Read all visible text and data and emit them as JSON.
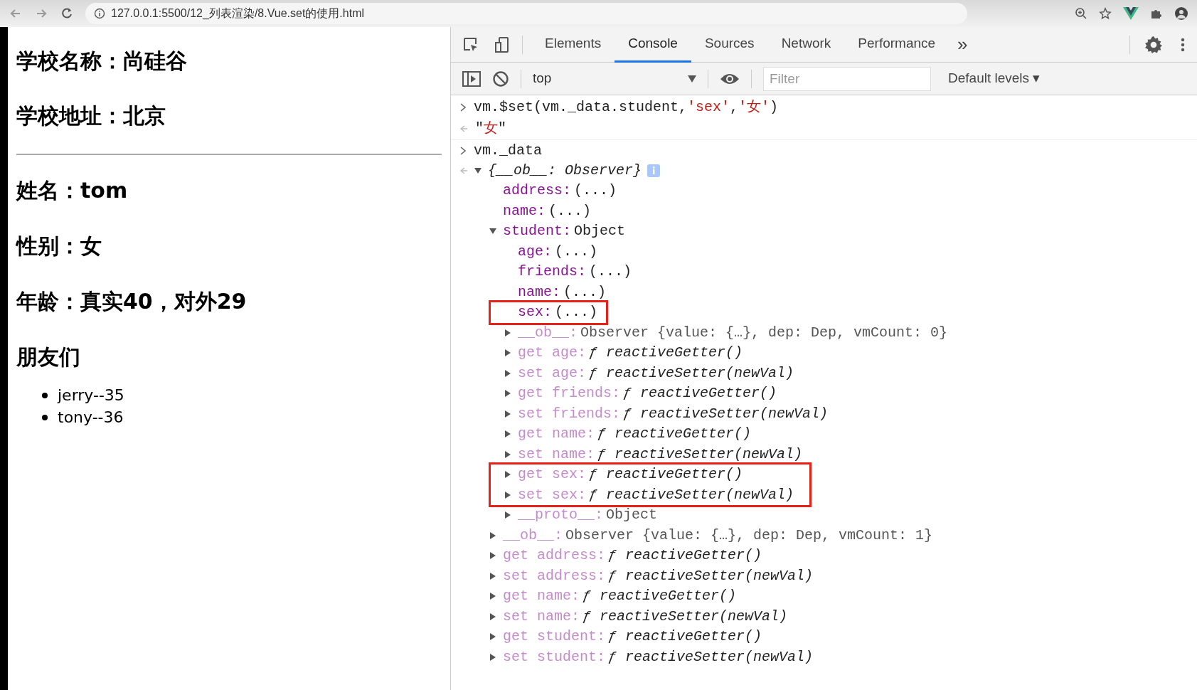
{
  "browser": {
    "url": "127.0.0.1:5500/12_列表渲染/8.Vue.set的使用.html"
  },
  "page": {
    "school": [
      "学校名称：尚硅谷",
      "学校地址：北京"
    ],
    "student": [
      "姓名：tom",
      "性别：女",
      "年龄：真实40，对外29"
    ],
    "friends_heading": "朋友们",
    "friends": [
      "jerry--35",
      "tony--36"
    ]
  },
  "devtools": {
    "tabs": [
      {
        "label": "Elements",
        "selected": false
      },
      {
        "label": "Console",
        "selected": true
      },
      {
        "label": "Sources",
        "selected": false
      },
      {
        "label": "Network",
        "selected": false
      },
      {
        "label": "Performance",
        "selected": false
      }
    ],
    "more": "»",
    "context": "top",
    "filter_placeholder": "Filter",
    "levels": "Default levels ▾"
  },
  "console": [
    {
      "kind": "input",
      "segments": [
        {
          "kind": "code",
          "text": "vm.$set(vm._data.student,"
        },
        {
          "kind": "string",
          "text": "'sex'"
        },
        {
          "kind": "code",
          "text": ","
        },
        {
          "kind": "string",
          "text": "'女'"
        },
        {
          "kind": "code",
          "text": ")"
        }
      ]
    },
    {
      "kind": "result",
      "segments": [
        {
          "kind": "code",
          "text": "\""
        },
        {
          "kind": "string",
          "text": "女"
        },
        {
          "kind": "code",
          "text": "\""
        }
      ]
    },
    {
      "kind": "input",
      "segments": [
        {
          "kind": "code",
          "text": "vm._data"
        }
      ]
    },
    {
      "kind": "object",
      "summary": "{__ob__: Observer}",
      "expanded": true,
      "children": [
        {
          "key": "address:",
          "kind": "property",
          "value": "(...)",
          "boxed": false
        },
        {
          "key": "name:",
          "kind": "property",
          "value": "(...)",
          "boxed": false
        },
        {
          "key": "student:",
          "kind": "property",
          "value": "Object",
          "boxed": false,
          "expanded": true,
          "children": [
            {
              "key": "age:",
              "kind": "property",
              "value": "(...)",
              "boxed": false
            },
            {
              "key": "friends:",
              "kind": "property",
              "value": "(...)",
              "boxed": false
            },
            {
              "key": "name:",
              "kind": "property",
              "value": "(...)",
              "boxed": false
            },
            {
              "key": "sex:",
              "kind": "property",
              "value": "(...)",
              "boxed": true
            },
            {
              "key": "__ob__:",
              "kind": "internal",
              "value": "Observer {value: {…}, dep: Dep, vmCount: 0}",
              "boxed": false,
              "expanded": false
            },
            {
              "key": "get age:",
              "kind": "accessor",
              "value": "ƒ reactiveGetter()",
              "boxed": false,
              "expanded": false
            },
            {
              "key": "set age:",
              "kind": "accessor",
              "value": "ƒ reactiveSetter(newVal)",
              "boxed": false,
              "expanded": false
            },
            {
              "key": "get friends:",
              "kind": "accessor",
              "value": "ƒ reactiveGetter()",
              "boxed": false,
              "expanded": false
            },
            {
              "key": "set friends:",
              "kind": "accessor",
              "value": "ƒ reactiveSetter(newVal)",
              "boxed": false,
              "expanded": false
            },
            {
              "key": "get name:",
              "kind": "accessor",
              "value": "ƒ reactiveGetter()",
              "boxed": false,
              "expanded": false
            },
            {
              "key": "set name:",
              "kind": "accessor",
              "value": "ƒ reactiveSetter(newVal)",
              "boxed": false,
              "expanded": false
            },
            {
              "key": "get sex:",
              "kind": "accessor",
              "value": "ƒ reactiveGetter()",
              "boxed": true,
              "expanded": false
            },
            {
              "key": "set sex:",
              "kind": "accessor",
              "value": "ƒ reactiveSetter(newVal)",
              "boxed": true,
              "expanded": false
            },
            {
              "key": "__proto__:",
              "kind": "internal",
              "value": "Object",
              "boxed": false,
              "expanded": false
            }
          ]
        },
        {
          "key": "__ob__:",
          "kind": "internal",
          "value": "Observer {value: {…}, dep: Dep, vmCount: 1}",
          "boxed": false,
          "expanded": false
        },
        {
          "key": "get address:",
          "kind": "accessor",
          "value": "ƒ reactiveGetter()",
          "boxed": false,
          "expanded": false
        },
        {
          "key": "set address:",
          "kind": "accessor",
          "value": "ƒ reactiveSetter(newVal)",
          "boxed": false,
          "expanded": false
        },
        {
          "key": "get name:",
          "kind": "accessor",
          "value": "ƒ reactiveGetter()",
          "boxed": false,
          "expanded": false
        },
        {
          "key": "set name:",
          "kind": "accessor",
          "value": "ƒ reactiveSetter(newVal)",
          "boxed": false,
          "expanded": false
        },
        {
          "key": "get student:",
          "kind": "accessor",
          "value": "ƒ reactiveGetter()",
          "boxed": false,
          "expanded": false
        },
        {
          "key": "set student:",
          "kind": "accessor",
          "value": "ƒ reactiveSetter(newVal)",
          "boxed": false,
          "expanded": false
        }
      ]
    }
  ]
}
